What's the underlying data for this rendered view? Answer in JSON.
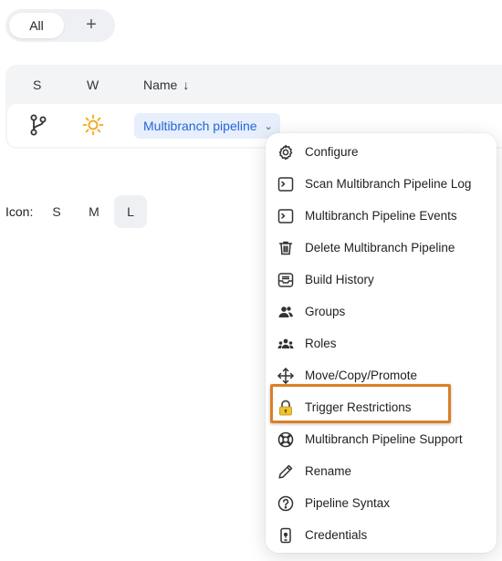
{
  "tabs": [
    {
      "label": "All",
      "active": true
    },
    {
      "label": "+",
      "icon": "plus-icon"
    }
  ],
  "table": {
    "headers": {
      "status": "S",
      "weather": "W",
      "name": "Name",
      "sort_icon": "arrow-down-icon"
    },
    "rows": [
      {
        "status_icon": "branch-icon",
        "weather_icon": "sun-icon",
        "name": "Multibranch pipeline"
      }
    ]
  },
  "icon_size": {
    "label": "Icon:",
    "options": [
      "S",
      "M",
      "L"
    ],
    "selected": "L"
  },
  "menu": {
    "items": [
      {
        "label": "Configure",
        "icon": "gear-icon"
      },
      {
        "label": "Scan Multibranch Pipeline Log",
        "icon": "terminal-icon"
      },
      {
        "label": "Multibranch Pipeline Events",
        "icon": "terminal-icon"
      },
      {
        "label": "Delete Multibranch Pipeline",
        "icon": "trash-icon"
      },
      {
        "label": "Build History",
        "icon": "inbox-icon"
      },
      {
        "label": "Groups",
        "icon": "people-icon"
      },
      {
        "label": "Roles",
        "icon": "people-group-icon"
      },
      {
        "label": "Move/Copy/Promote",
        "icon": "move-icon"
      },
      {
        "label": "Trigger Restrictions",
        "icon": "lock-icon",
        "highlighted": true
      },
      {
        "label": "Multibranch Pipeline Support",
        "icon": "lifebuoy-icon"
      },
      {
        "label": "Rename",
        "icon": "pencil-icon"
      },
      {
        "label": "Pipeline Syntax",
        "icon": "help-circle-icon"
      },
      {
        "label": "Credentials",
        "icon": "phone-key-icon"
      }
    ]
  },
  "colors": {
    "accent": "#2566d5",
    "highlight_border": "#d98027",
    "sun": "#f0a81c",
    "lock": "#f2c230"
  }
}
